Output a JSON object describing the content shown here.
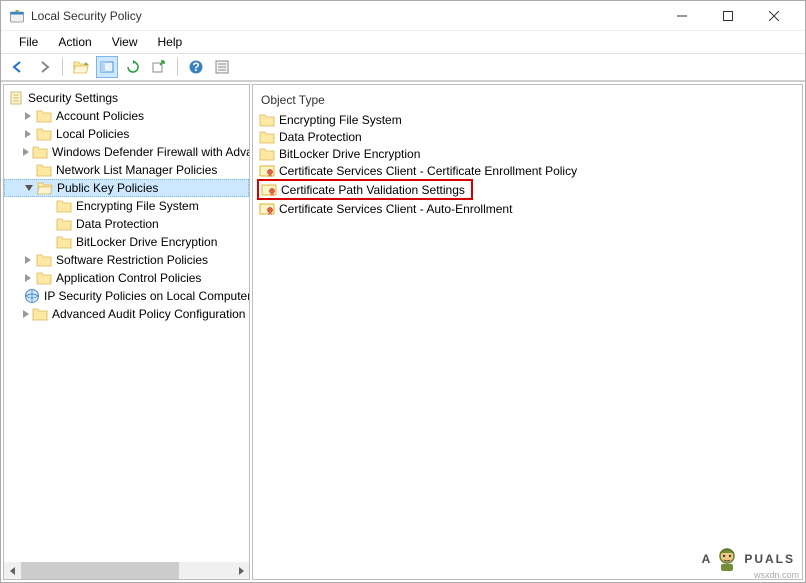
{
  "window": {
    "title": "Local Security Policy"
  },
  "menu": {
    "file": "File",
    "action": "Action",
    "view": "View",
    "help": "Help"
  },
  "tree": {
    "root": "Security Settings",
    "account_policies": "Account Policies",
    "local_policies": "Local Policies",
    "firewall": "Windows Defender Firewall with Advanced Security",
    "network_list": "Network List Manager Policies",
    "public_key": "Public Key Policies",
    "efs": "Encrypting File System",
    "data_protection": "Data Protection",
    "bitlocker": "BitLocker Drive Encryption",
    "software_restriction": "Software Restriction Policies",
    "app_control": "Application Control Policies",
    "ip_security": "IP Security Policies on Local Computer",
    "advanced_audit": "Advanced Audit Policy Configuration"
  },
  "right": {
    "header": "Object Type",
    "items": {
      "efs": "Encrypting File System",
      "data_protection": "Data Protection",
      "bitlocker": "BitLocker Drive Encryption",
      "cert_enroll_policy": "Certificate Services Client - Certificate Enrollment Policy",
      "cert_path_validation": "Certificate Path Validation Settings",
      "cert_auto_enroll": "Certificate Services Client - Auto-Enrollment"
    }
  },
  "watermark": {
    "text_before": "A",
    "text_after": "PUALS"
  },
  "source": "wsxdn.com"
}
